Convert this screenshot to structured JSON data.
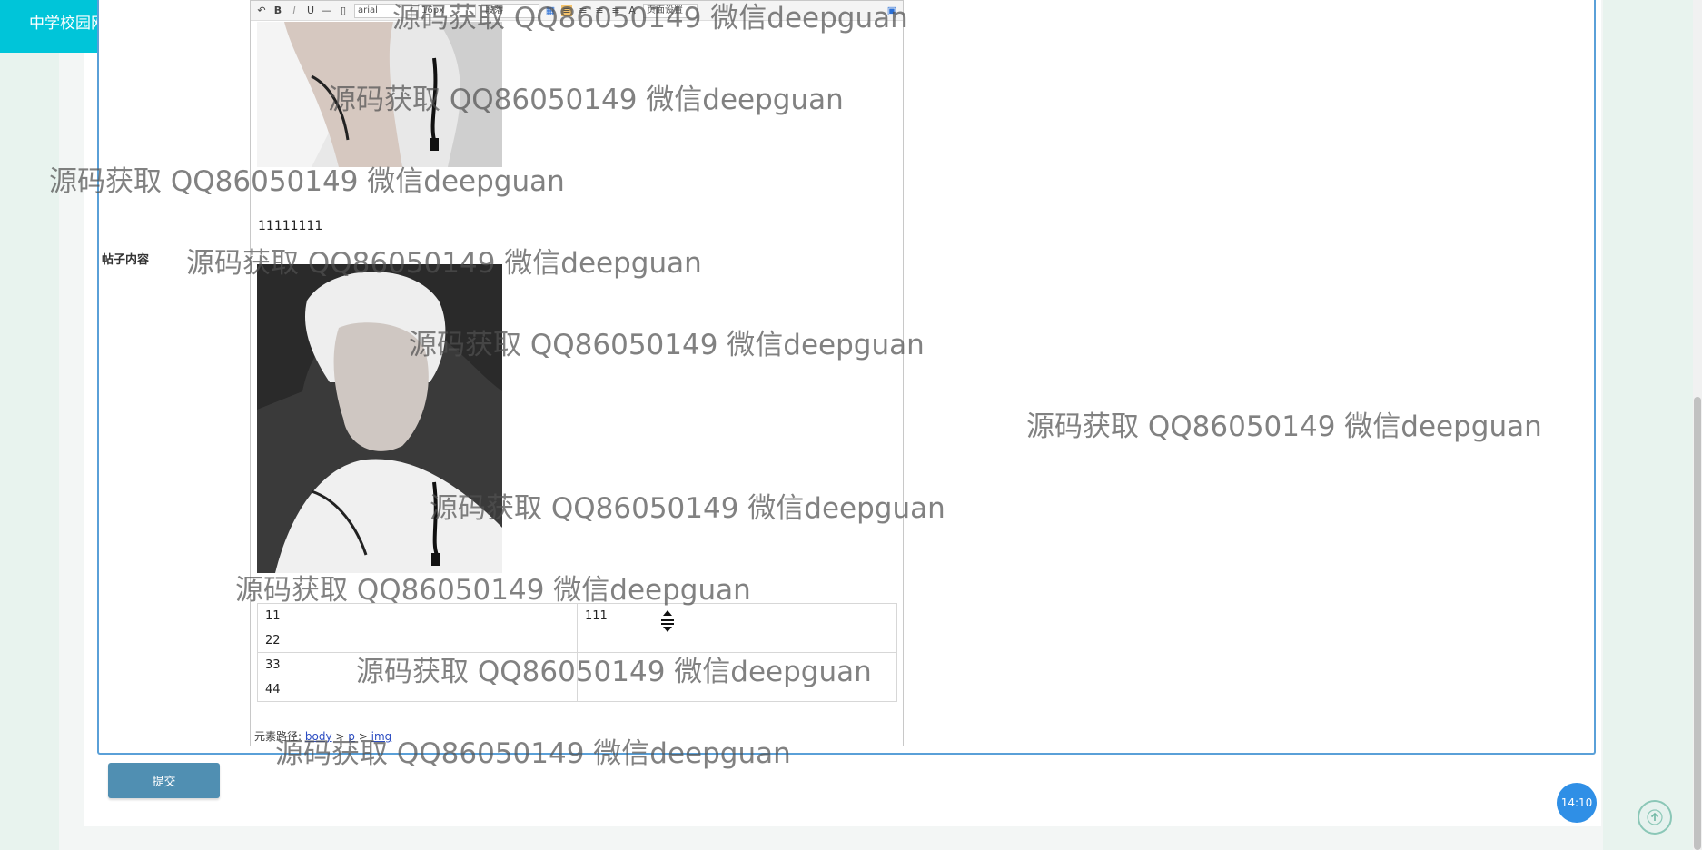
{
  "header": {
    "site_title": "中学校园网站",
    "fullscreen_icon": "fullscreen-icon",
    "avatar_icon": "user-avatar-icon",
    "colors": {
      "bar": "#00c5d9",
      "avatar": "#f5c242"
    }
  },
  "form": {
    "label": "帖子内容",
    "submit_label": "提交"
  },
  "editor": {
    "toolbar": {
      "bold": "B",
      "underline": "U",
      "font_family": "arial",
      "font_size": "16px",
      "paragraph": "段落",
      "text_color": "A",
      "page_setup": "页面设置"
    },
    "paragraph_text": "11111111",
    "table_rows": [
      [
        "11",
        "111"
      ],
      [
        "22",
        ""
      ],
      [
        "33",
        ""
      ],
      [
        "44",
        ""
      ]
    ],
    "status_bar": {
      "prefix": "元素路径:",
      "path": [
        "body",
        "p",
        "img"
      ],
      "separator": ">"
    }
  },
  "clock_badge": "14:10",
  "back_to_top_icon": "arrow-up-icon",
  "watermarks": [
    "源码获取 QQ86050149 微信deepguan",
    "源码获取 QQ86050149 微信deepguan",
    "源码获取 QQ86050149 微信deepguan",
    "源码获取 QQ86050149 微信deepguan",
    "源码获取 QQ86050149 微信deepguan",
    "源码获取 QQ86050149 微信deepguan",
    "源码获取 QQ86050149 微信deepguan",
    "源码获取 QQ86050149 微信deepguan",
    "源码获取 QQ86050149 微信deepguan",
    "源码获取 QQ86050149 微信deepguan"
  ]
}
